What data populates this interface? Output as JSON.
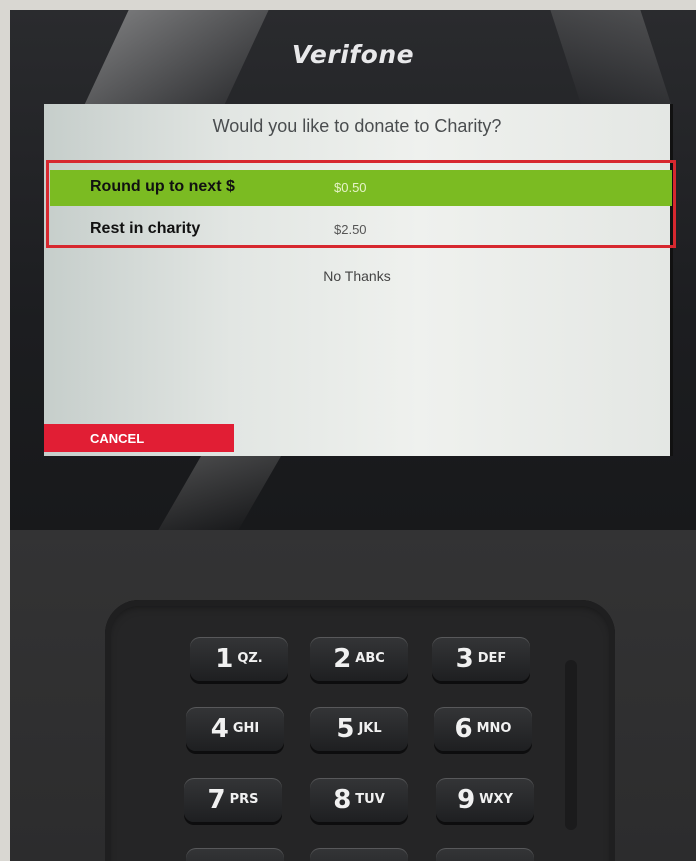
{
  "device": {
    "brand": "Verifone"
  },
  "screen": {
    "question": "Would you like to donate to Charity?",
    "options": [
      {
        "label": "Round up to next $",
        "amount": "$0.50"
      },
      {
        "label": "Rest in charity",
        "amount": "$2.50"
      }
    ],
    "no_thanks": "No Thanks",
    "cancel": "CANCEL"
  },
  "keypad": {
    "keys": [
      {
        "digit": "1",
        "letters": "QZ."
      },
      {
        "digit": "2",
        "letters": "ABC"
      },
      {
        "digit": "3",
        "letters": "DEF"
      },
      {
        "digit": "4",
        "letters": "GHI"
      },
      {
        "digit": "5",
        "letters": "JKL"
      },
      {
        "digit": "6",
        "letters": "MNO"
      },
      {
        "digit": "7",
        "letters": "PRS"
      },
      {
        "digit": "8",
        "letters": "TUV"
      },
      {
        "digit": "9",
        "letters": "WXY"
      }
    ]
  },
  "colors": {
    "selected_option": "#7bbb22",
    "cancel_button": "#e11e34",
    "highlight_border": "#d7282f"
  }
}
